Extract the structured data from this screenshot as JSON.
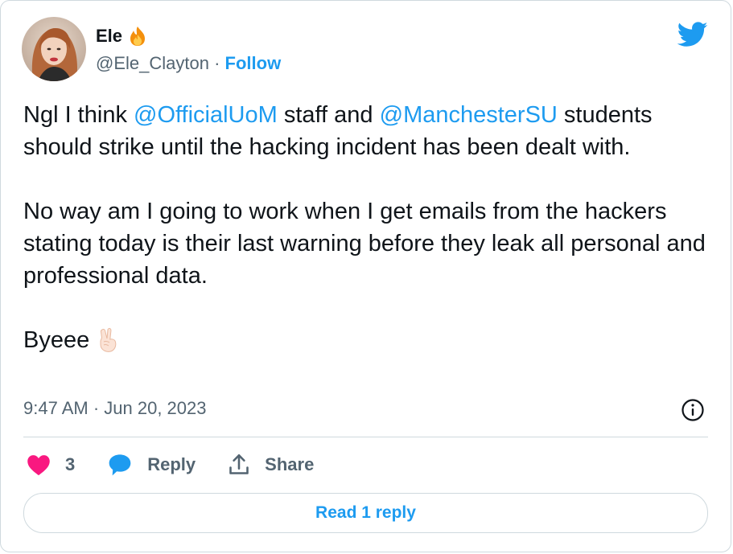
{
  "author": {
    "display_name": "Ele",
    "handle": "@Ele_Clayton",
    "separator": " · ",
    "follow_label": "Follow"
  },
  "tweet": {
    "line1_prefix": "Ngl I think ",
    "mention1": "@OfficialUoM",
    "line1_middle": " staff and ",
    "mention2": "@ManchesterSU",
    "line1_suffix": " students should strike until the hacking incident has been dealt with.",
    "paragraph2": "No way am I going to work when I get emails from the hackers stating today is their last warning before they leak all personal and professional data.",
    "paragraph3": "Byeee"
  },
  "timestamp": "9:47 AM · Jun 20, 2023",
  "actions": {
    "like_count": "3",
    "reply_label": "Reply",
    "share_label": "Share"
  },
  "read_replies_label": "Read 1 reply",
  "colors": {
    "accent": "#1d9bf0",
    "like": "#f91880",
    "text": "#0f1419",
    "muted": "#536471",
    "border": "#cfd9de"
  },
  "icons": [
    "avatar",
    "fire-emoji",
    "twitter-bird-icon",
    "peace-hand-emoji",
    "info-icon",
    "heart-icon",
    "reply-bubble-icon",
    "share-icon"
  ]
}
